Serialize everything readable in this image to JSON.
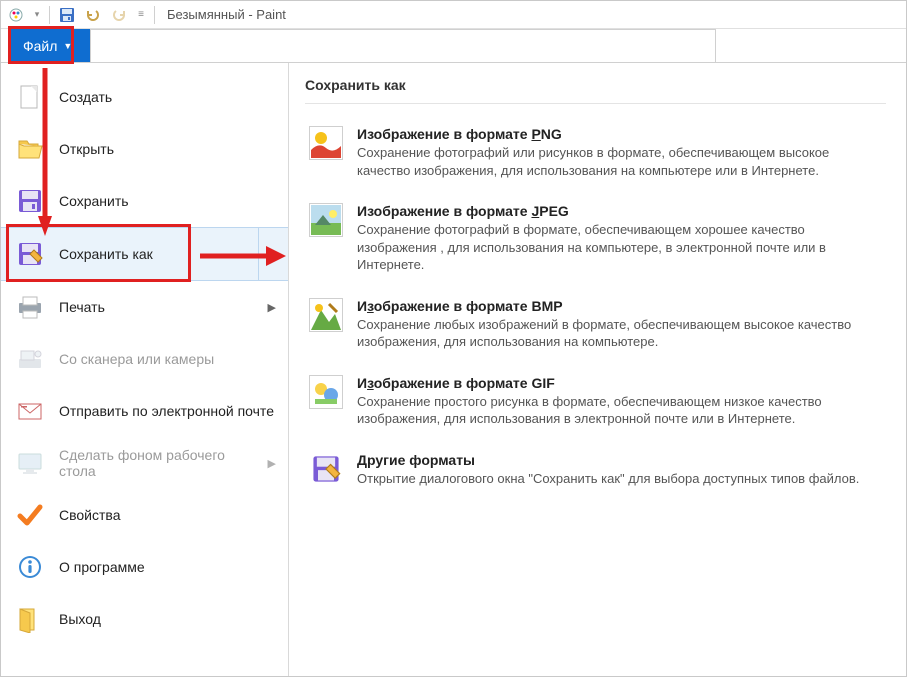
{
  "title": "Безымянный - Paint",
  "ribbon": {
    "file_tab": "Файл"
  },
  "menu": {
    "new": "Создать",
    "open": "Открыть",
    "save": "Сохранить",
    "save_as": "Сохранить как",
    "print": "Печать",
    "scanner": "Со сканера или камеры",
    "send_email": "Отправить по электронной почте",
    "set_wallpaper": "Сделать фоном рабочего стола",
    "properties": "Свойства",
    "about": "О программе",
    "exit": "Выход"
  },
  "content": {
    "header": "Сохранить как",
    "formats": [
      {
        "title_pre": "Изображение в формате ",
        "title_u": "P",
        "title_post": "NG",
        "desc": "Сохранение фотографий или рисунков в формате, обеспечивающем высокое качество изображения, для использования на компьютере или в Интернете."
      },
      {
        "title_pre": "Изображение в формате ",
        "title_u": "J",
        "title_post": "PEG",
        "desc": "Сохранение фотографий в формате, обеспечивающем хорошее качество изображения , для использования на компьютере, в электронной почте или в Интернете."
      },
      {
        "title_pre": "И",
        "title_u": "з",
        "title_post": "ображение в формате BMP",
        "desc": "Сохранение любых изображений в формате, обеспечивающем высокое качество изображения, для использования на компьютере."
      },
      {
        "title_pre": "И",
        "title_u": "з",
        "title_post": "ображение в формате GIF",
        "desc": "Сохранение простого рисунка в формате, обеспечивающем низкое качество изображения, для использования в электронной почте или в Интернете."
      },
      {
        "title_pre": "",
        "title_u": "Д",
        "title_post": "ругие форматы",
        "desc": "Открытие диалогового окна \"Сохранить как\" для выбора доступных типов файлов."
      }
    ]
  },
  "icons": {
    "new": "new-sheet-icon",
    "open": "folder-open-icon",
    "save": "floppy-icon",
    "save_as": "floppy-pencil-icon",
    "print": "printer-icon",
    "scanner": "scanner-icon",
    "email": "envelope-icon",
    "wallpaper": "desktop-icon",
    "properties": "checkmark-icon",
    "about": "info-icon",
    "exit": "exit-icon"
  },
  "colors": {
    "accent": "#0f6dd0",
    "highlight": "#e02020",
    "hover_bg": "#eaf3fb"
  }
}
